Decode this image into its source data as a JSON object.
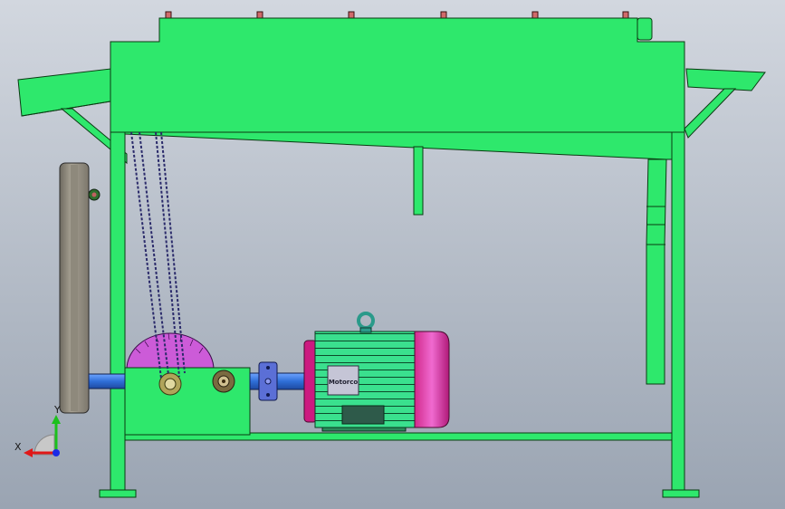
{
  "viewport": {
    "background_top": "#d2d7df",
    "background_bottom": "#9aa4b2"
  },
  "model": {
    "frame_color": "#2ee86c",
    "frame_edge": "#0a3a12",
    "pulley_color": "#9a9486",
    "saw_blade_color": "#cc5bd8",
    "motor_body_color": "#33e08a",
    "motor_cap_color": "#cc1a80",
    "motor_plate_color": "#c5c5d6",
    "motor_plate_text": "Motorco",
    "coupling_color": "#5b6fd6",
    "shaft_color": "#3f7fe0",
    "belt_color": "#2a2a6a"
  },
  "triad": {
    "x_label": "X",
    "y_label": "Y",
    "x_color": "#e01818",
    "y_color": "#1cc01c",
    "z_color": "#1a2ae6"
  }
}
